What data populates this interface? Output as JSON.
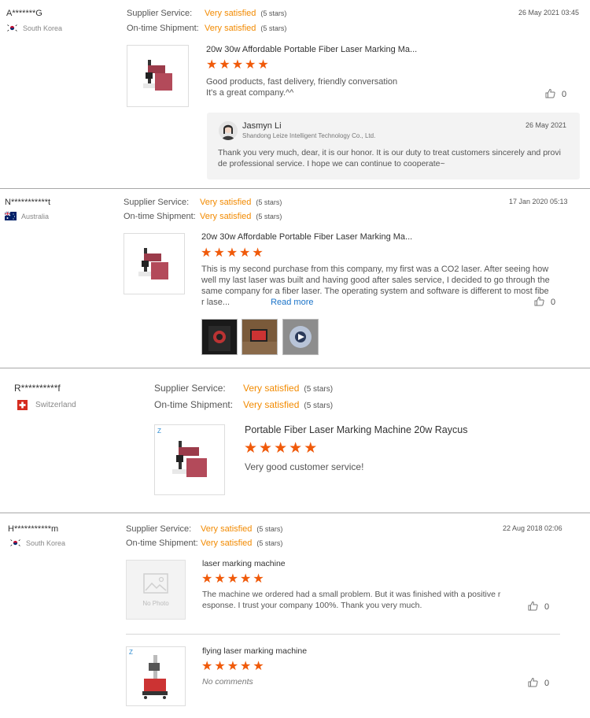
{
  "reviews": [
    {
      "user": "A*******G",
      "country": "South Korea",
      "supplier_label": "Supplier Service:",
      "supplier_value": "Very satisfied",
      "supplier_stars": "(5 stars)",
      "shipment_label": "On-time Shipment:",
      "shipment_value": "Very satisfied",
      "shipment_stars": "(5 stars)",
      "date": "26 May 2021 03:45",
      "product": "20w 30w Affordable Portable Fiber Laser Marking Ma...",
      "rating": 5,
      "text_line1": "Good products, fast delivery, friendly conversation",
      "text_line2": "It's a great company.^^",
      "likes": "0",
      "reply": {
        "name": "Jasmyn Li",
        "company": "Shandong Leize Intelligent Technology Co., Ltd.",
        "date": "26 May 2021",
        "text_line1": "Thank you very much, dear, it is our honor. It is our duty to treat customers sincerely and provi",
        "text_line2": "de professional service. I hope we can continue to cooperate~"
      }
    },
    {
      "user": "N***********t",
      "country": "Australia",
      "supplier_label": "Supplier Service:",
      "supplier_value": "Very satisfied",
      "supplier_stars": "(5 stars)",
      "shipment_label": "On-time Shipment:",
      "shipment_value": "Very satisfied",
      "shipment_stars": "(5 stars)",
      "date": "17 Jan 2020 05:13",
      "product": "20w 30w Affordable Portable Fiber Laser Marking Ma...",
      "rating": 5,
      "text_line1": "This is my second purchase from this company, my first was a CO2 laser. After seeing how",
      "text_line2": "well my last laser was built and having good after sales service, I decided to go through the",
      "text_line3": "same company for a fiber laser. The operating system and software is different to most fibe",
      "text_line4": "r lase...",
      "read_more": "Read more",
      "likes": "0"
    },
    {
      "user": "R**********f",
      "country": "Switzerland",
      "supplier_label": "Supplier Service:",
      "supplier_value": "Very satisfied",
      "supplier_stars": "(5 stars)",
      "shipment_label": "On-time Shipment:",
      "shipment_value": "Very satisfied",
      "shipment_stars": "(5 stars)",
      "product": "Portable Fiber Laser Marking Machine 20w Raycus",
      "rating": 5,
      "text_line1": "Very good customer service!"
    },
    {
      "user": "H***********m",
      "country": "South Korea",
      "supplier_label": "Supplier Service:",
      "supplier_value": "Very satisfied",
      "supplier_stars": "(5 stars)",
      "shipment_label": "On-time Shipment:",
      "shipment_value": "Very satisfied",
      "shipment_stars": "(5 stars)",
      "date": "22 Aug 2018 02:06",
      "items": [
        {
          "product": "laser marking machine",
          "no_photo": "No Photo",
          "rating": 5,
          "text_line1": "The machine we ordered had a small problem. But it was finished with a positive r",
          "text_line2": "esponse. I trust your company 100%. Thank you very much.",
          "likes": "0"
        },
        {
          "product": "flying laser marking machine",
          "rating": 5,
          "text_line1": "No comments",
          "likes": "0"
        }
      ]
    }
  ],
  "colors": {
    "accent": "#f28a00",
    "star": "#f05a0a",
    "link": "#1a73c8"
  }
}
